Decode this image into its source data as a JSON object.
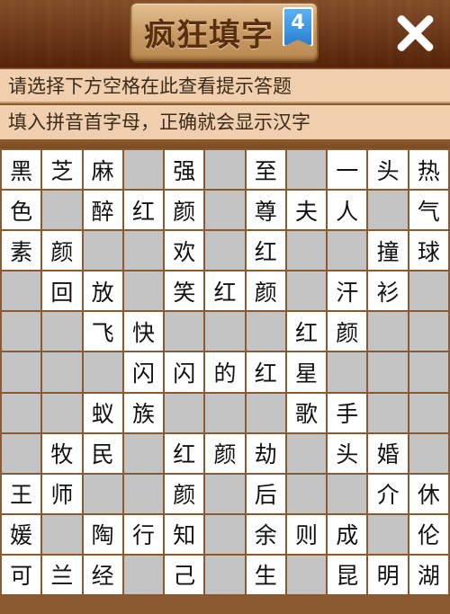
{
  "header": {
    "title": "疯狂填字",
    "level": "4"
  },
  "hints": {
    "line1": "请选择下方空格在此查看提示答题",
    "line2": "填入拼音首字母，正确就会显示汉字"
  },
  "colors": {
    "wood": "#8a5a2e",
    "hint_bg": "#f0cfae",
    "cell_letter": "#ffffff",
    "cell_block": "#c3c3c3",
    "badge": "#2a7fd0"
  },
  "grid": {
    "rows": [
      [
        "黑",
        "芝",
        "麻",
        "",
        "强",
        "",
        "至",
        "",
        "一",
        "头",
        "热"
      ],
      [
        "色",
        "",
        "醉",
        "红",
        "颜",
        "",
        "尊",
        "夫",
        "人",
        "",
        "气"
      ],
      [
        "素",
        "颜",
        "",
        "",
        "欢",
        "",
        "红",
        "",
        "",
        "撞",
        "球"
      ],
      [
        "",
        "回",
        "放",
        "",
        "笑",
        "红",
        "颜",
        "",
        "汗",
        "衫",
        ""
      ],
      [
        "",
        "",
        "飞",
        "快",
        "",
        "",
        "",
        "红",
        "颜",
        "",
        ""
      ],
      [
        "",
        "",
        "",
        "闪",
        "闪",
        "的",
        "红",
        "星",
        "",
        "",
        ""
      ],
      [
        "",
        "",
        "蚁",
        "族",
        "",
        "",
        "",
        "歌",
        "手",
        "",
        ""
      ],
      [
        "",
        "牧",
        "民",
        "",
        "红",
        "颜",
        "劫",
        "",
        "头",
        "婚",
        ""
      ],
      [
        "王",
        "师",
        "",
        "",
        "颜",
        "",
        "后",
        "",
        "",
        "介",
        "休"
      ],
      [
        "媛",
        "",
        "陶",
        "行",
        "知",
        "",
        "余",
        "则",
        "成",
        "",
        "伦"
      ],
      [
        "可",
        "兰",
        "经",
        "",
        "己",
        "",
        "生",
        "",
        "昆",
        "明",
        "湖"
      ]
    ]
  }
}
